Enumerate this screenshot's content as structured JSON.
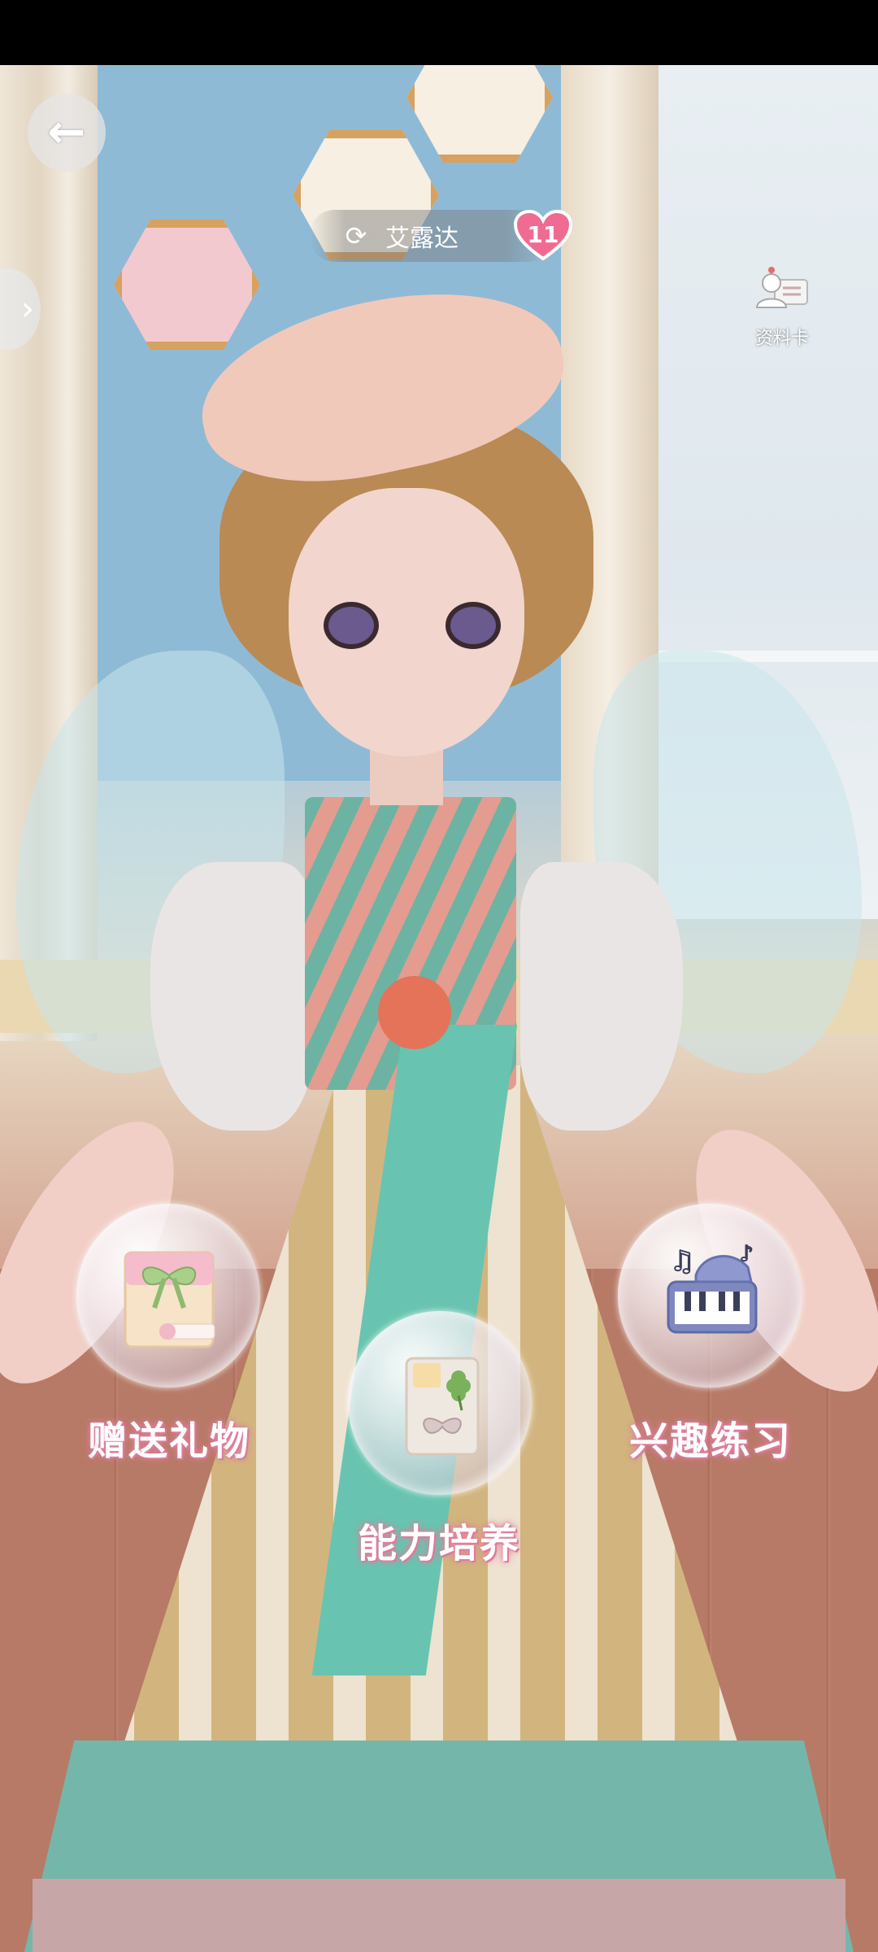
{
  "header": {
    "character_name": "艾露达",
    "affinity_level": "11",
    "profile_card_label": "资料卡"
  },
  "actions": [
    {
      "label": "赠送礼物",
      "icon": "gift-bag-icon"
    },
    {
      "label": "能力培养",
      "icon": "clover-book-icon"
    },
    {
      "label": "兴趣练习",
      "icon": "piano-music-icon"
    }
  ],
  "colors": {
    "heart": "#f06a92",
    "label_glow": "#e07f9d"
  }
}
